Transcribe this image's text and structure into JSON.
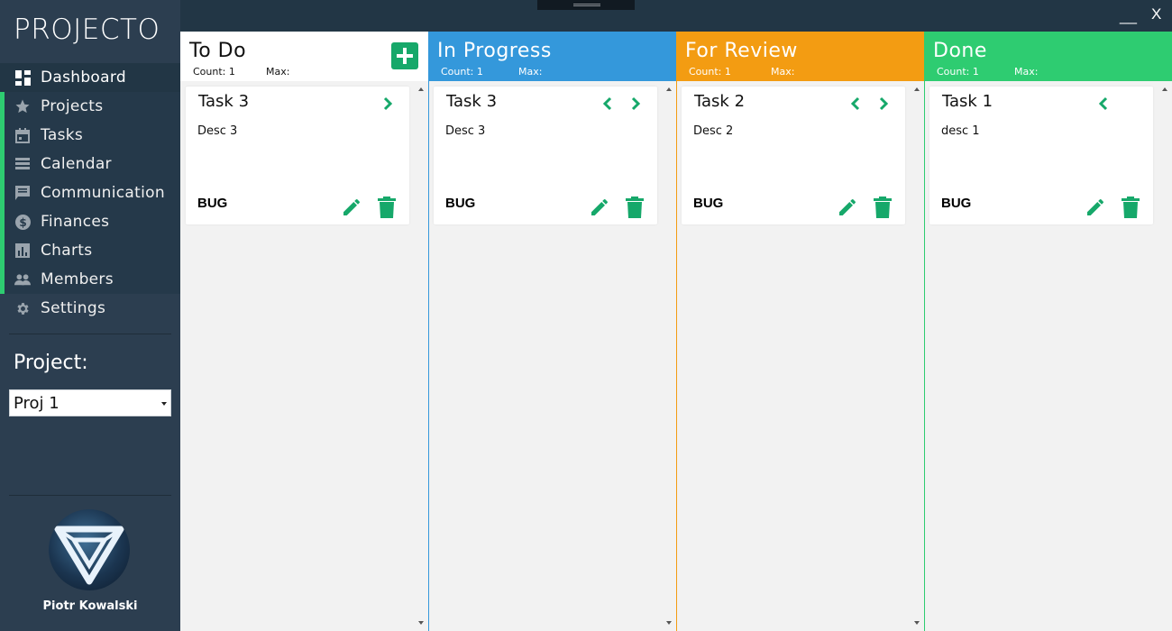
{
  "app": {
    "name": "PROJECTO",
    "window_controls": {
      "minimize": "__",
      "close": "X"
    }
  },
  "sidebar": {
    "items": [
      {
        "label": "Dashboard",
        "icon": "dashboard-icon"
      },
      {
        "label": "Projects",
        "icon": "star-icon"
      },
      {
        "label": "Tasks",
        "icon": "calendar-icon"
      },
      {
        "label": "Calendar",
        "icon": "list-icon"
      },
      {
        "label": "Communication",
        "icon": "chat-icon"
      },
      {
        "label": "Finances",
        "icon": "dollar-icon"
      },
      {
        "label": "Charts",
        "icon": "bar-chart-icon"
      },
      {
        "label": "Members",
        "icon": "people-icon"
      },
      {
        "label": "Settings",
        "icon": "gear-icon"
      }
    ],
    "project_label": "Project:",
    "project_selected": "Proj 1",
    "user_name": "Piotr Kowalski"
  },
  "board": {
    "colors": {
      "accent": "#16a86a",
      "todo": "#ffffff",
      "in_progress": "#3498db",
      "for_review": "#f39c12",
      "done": "#2ecc71"
    },
    "columns": [
      {
        "title": "To Do",
        "count_label": "Count: 1",
        "max_label": "Max:",
        "card": {
          "title": "Task 3",
          "desc": "Desc 3",
          "tag": "BUG",
          "arrows": [
            "right"
          ]
        }
      },
      {
        "title": "In Progress",
        "count_label": "Count: 1",
        "max_label": "Max:",
        "card": {
          "title": "Task 3",
          "desc": "Desc 3",
          "tag": "BUG",
          "arrows": [
            "left",
            "right"
          ]
        }
      },
      {
        "title": "For Review",
        "count_label": "Count: 1",
        "max_label": "Max:",
        "card": {
          "title": "Task 2",
          "desc": "Desc 2",
          "tag": "BUG",
          "arrows": [
            "left",
            "right"
          ]
        }
      },
      {
        "title": "Done",
        "count_label": "Count: 1",
        "max_label": "Max:",
        "card": {
          "title": "Task 1",
          "desc": "desc 1",
          "tag": "BUG",
          "arrows": [
            "left"
          ]
        }
      }
    ]
  }
}
